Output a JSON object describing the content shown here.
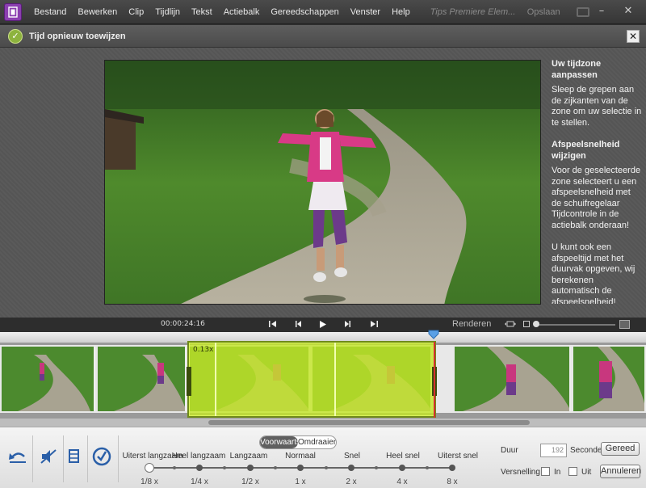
{
  "menubar": {
    "app_icon": "film-strip-icon",
    "items": [
      "Bestand",
      "Bewerken",
      "Clip",
      "Tijdlijn",
      "Tekst",
      "Actiebalk",
      "Gereedschappen",
      "Venster",
      "Help"
    ],
    "tips": "Tips Premiere Elem...",
    "save": "Opslaan",
    "minimize": "–",
    "close": "✕"
  },
  "dialog": {
    "title": "Tijd opnieuw toewijzen",
    "icon": "clock-check-icon",
    "close": "✕"
  },
  "help": {
    "heading1": "Uw tijdzone aanpassen",
    "text1": "Sleep de grepen aan de zijkanten van de zone om uw selectie in te stellen.",
    "heading2": "Afspeelsnelheid wijzigen",
    "text2": "Voor de geselecteerde zone selecteert u een afspeelsnelheid met de schuifregelaar Tijdcontrole in de actiebalk onderaan!",
    "text3": "U kunt ook een afspeeltijd met het duurvak opgeven, wij berekenen automatisch de afspeelsnelheid!"
  },
  "playback": {
    "timecode": "00:00:24:16",
    "render": "Renderen",
    "buttons": [
      "go-to-start-icon",
      "step-back-icon",
      "play-icon",
      "step-forward-icon",
      "go-to-end-icon"
    ]
  },
  "timeline": {
    "selection_duration": "0.13x",
    "scroll_position": 0.32
  },
  "actionbar": {
    "direction": {
      "forward": "Voorwaarts",
      "reverse": "Omdraaien"
    },
    "speed_labels": [
      "Uiterst langzaam",
      "Heel langzaam",
      "Langzaam",
      "Normaal",
      "Snel",
      "Heel snel",
      "Uiterst snel"
    ],
    "speed_values": [
      "1/8 x",
      "1/4 x",
      "1/2 x",
      "1 x",
      "2 x",
      "4 x",
      "8 x"
    ],
    "selected_speed_index": 0,
    "duur_label": "Duur",
    "duur_value": "192",
    "seconden_label": "Seconden",
    "gereed": "Gereed",
    "versnelling_label": "Versnelling",
    "in_label": "In",
    "uit_label": "Uit",
    "annuleren": "Annuleren"
  },
  "colors": {
    "accent": "#8db33e",
    "selection": "#c4e628",
    "app_icon": "#8b3fb0"
  }
}
